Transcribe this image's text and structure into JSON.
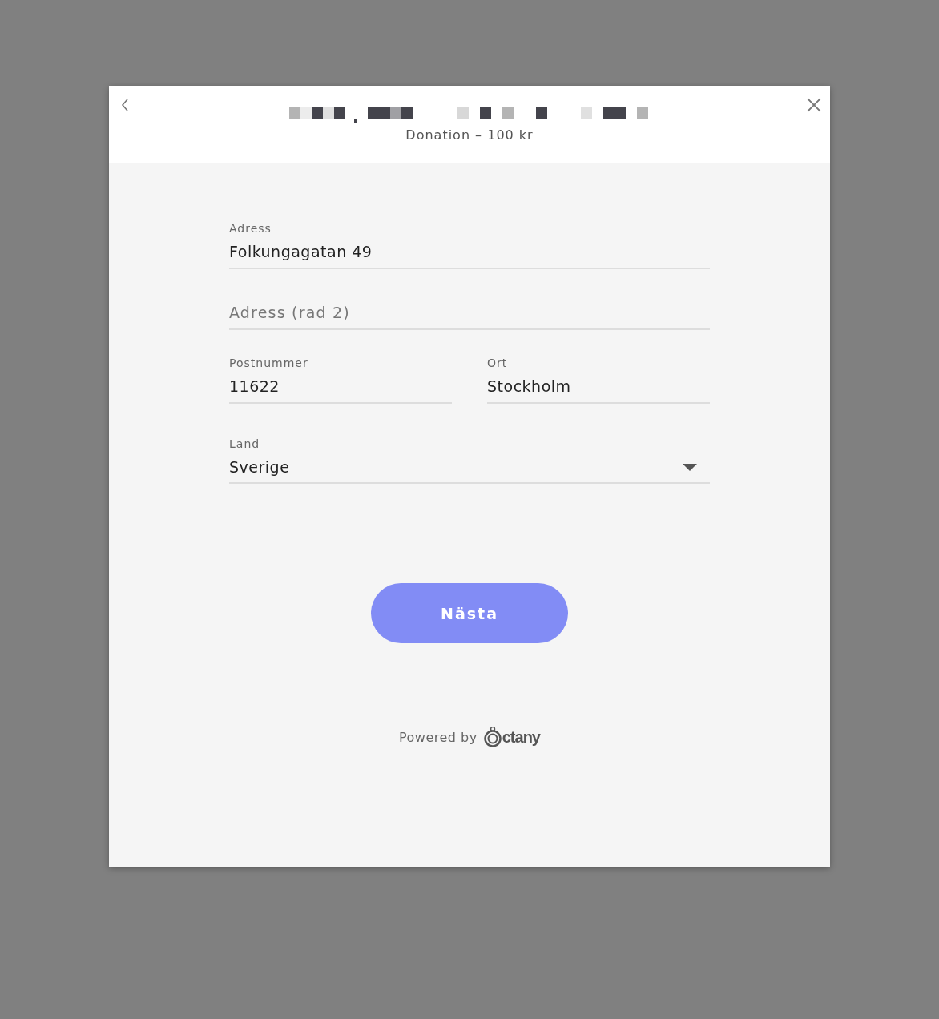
{
  "header": {
    "subtitle": "Donation – 100 kr"
  },
  "fields": [
    {
      "kind": "text",
      "label": "Adress",
      "value": "Folkungagatan 49"
    },
    {
      "kind": "text",
      "placeholder": "Adress (rad 2)"
    },
    {
      "kind": "pair",
      "items": [
        {
          "label": "Postnummer",
          "value": "11622"
        },
        {
          "label": "Ort",
          "value": "Stockholm"
        }
      ]
    },
    {
      "kind": "select",
      "label": "Land",
      "value": "Sverige"
    }
  ],
  "button": "Nästa",
  "footer": {
    "text": "Powered by",
    "logo_text": "ctany"
  }
}
